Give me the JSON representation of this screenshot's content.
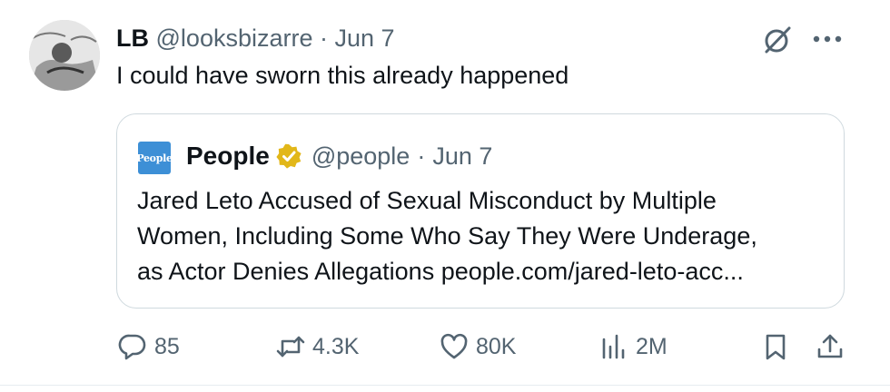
{
  "tweet": {
    "display_name": "LB",
    "handle": "@looksbizarre",
    "separator": "·",
    "date": "Jun 7",
    "text": "I could have sworn this already happened"
  },
  "quoted": {
    "logo_text": "People",
    "display_name": "People",
    "handle": "@people",
    "separator": "·",
    "date": "Jun 7",
    "lines": [
      "Jared Leto Accused of Sexual Misconduct by Multiple",
      "Women, Including Some Who Say They Were Underage,",
      "as Actor Denies Allegations people.com/jared-leto-acc..."
    ]
  },
  "actions": {
    "replies": "85",
    "reposts": "4.3K",
    "likes": "80K",
    "views": "2M"
  },
  "colors": {
    "text": "#0f1419",
    "muted": "#536471",
    "border": "#cfd9de",
    "verified_gold": "#e2b719",
    "people_blue": "#3d8fd6"
  },
  "icons": [
    "grok-icon",
    "more-icon",
    "verified-badge-icon",
    "reply-icon",
    "repost-icon",
    "like-icon",
    "views-icon",
    "bookmark-icon",
    "share-icon"
  ]
}
